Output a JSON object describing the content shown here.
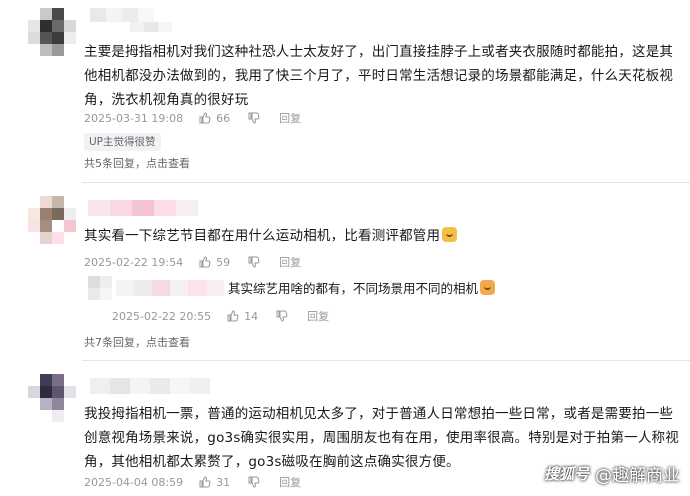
{
  "comments": [
    {
      "text": "主要是拇指相机对我们这种社恐人士太友好了，出门直接挂脖子上或者夹衣服随时都能拍，这是其他相机都没办法做到的，我用了快三个月了，平时日常生活想记录的场景都能满足，什么天花板视角，洗衣机视角真的很好玩",
      "date": "2025-03-31 19:08",
      "likes": "66",
      "reply_label": "回复",
      "up_tag": "UP主觉得很赞",
      "sub_summary": "共5条回复，点击查看"
    },
    {
      "text": "其实看一下综艺节目都在用什么运动相机，比看测评都管用",
      "date": "2025-02-22 19:54",
      "likes": "59",
      "reply_label": "回复",
      "reply": {
        "text": "其实综艺用啥的都有，不同场景用不同的相机",
        "date": "2025-02-22 20:55",
        "likes": "14",
        "reply_label": "回复"
      },
      "sub_summary": "共7条回复，点击查看"
    },
    {
      "text": "我投拇指相机一票，普通的运动相机见太多了，对于普通人日常想拍一些日常，或者是需要拍一些创意视角场景来说，go3s确实很实用，周围朋友也有在用，使用率很高。特别是对于拍第一人称视角，其他相机都太累赘了，go3s磁吸在胸前这点确实很方便。",
      "date": "2025-04-04 08:59",
      "likes": "31",
      "reply_label": "回复"
    }
  ],
  "watermark": {
    "platform": "搜狐号",
    "account": "@趣解商业"
  },
  "icons": {
    "like": "thumbs-up-icon",
    "dislike": "thumbs-down-icon",
    "emoji": "emoji-icon"
  }
}
